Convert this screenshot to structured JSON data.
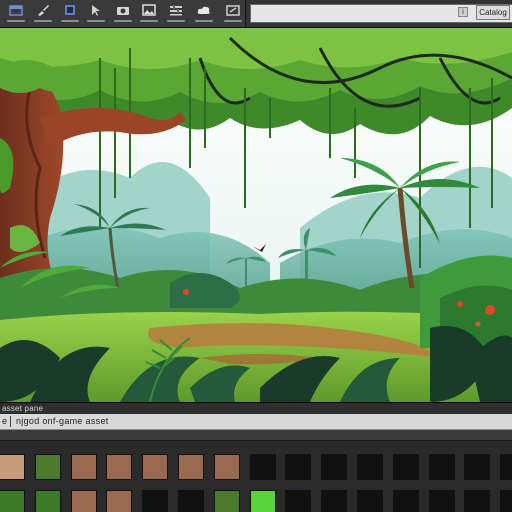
{
  "toolbar": {
    "tools": [
      {
        "name": "file-tool",
        "icon": "window-icon",
        "color": "#6f8ed6"
      },
      {
        "name": "brush-tool",
        "icon": "brush-icon",
        "color": "#d9d9d9"
      },
      {
        "name": "layers-tool",
        "icon": "layers-icon",
        "color": "#5b7fcf"
      },
      {
        "name": "select-tool",
        "icon": "select-icon",
        "color": "#cfcfcf"
      },
      {
        "name": "camera-tool",
        "icon": "camera-icon",
        "color": "#d6d6d6"
      },
      {
        "name": "image-tool",
        "icon": "image-icon",
        "color": "#e0e0e0"
      },
      {
        "name": "settings-tool",
        "icon": "sliders-icon",
        "color": "#cfcfcf"
      },
      {
        "name": "cloud-tool",
        "icon": "cloud-icon",
        "color": "#e6e6e6"
      },
      {
        "name": "export-tool",
        "icon": "export-icon",
        "color": "#d0d0d0"
      }
    ],
    "search_badge": "i",
    "catalog_label": "Catalog"
  },
  "panel": {
    "title": "asset pane",
    "tab_label": "e",
    "asset_name": "njgod onf-game asset"
  },
  "palette": {
    "row1": [
      "#c79a78",
      "#4a7a2a",
      "#9a6a50",
      "#9a6a50",
      "#9a6a50",
      "#9a6a50",
      "#9a6a50",
      "#111111",
      "#111111",
      "#111111",
      "#111111",
      "#111111",
      "#111111",
      "#111111",
      "#111111"
    ],
    "row2": [
      "#3d7a28",
      "#3d7a28",
      "#9a6a50",
      "#9a6a50",
      "#111111",
      "#111111",
      "#4a7a2a",
      "#5ad43c",
      "#111111",
      "#111111",
      "#111111",
      "#111111",
      "#111111",
      "#111111",
      "#111111"
    ]
  }
}
